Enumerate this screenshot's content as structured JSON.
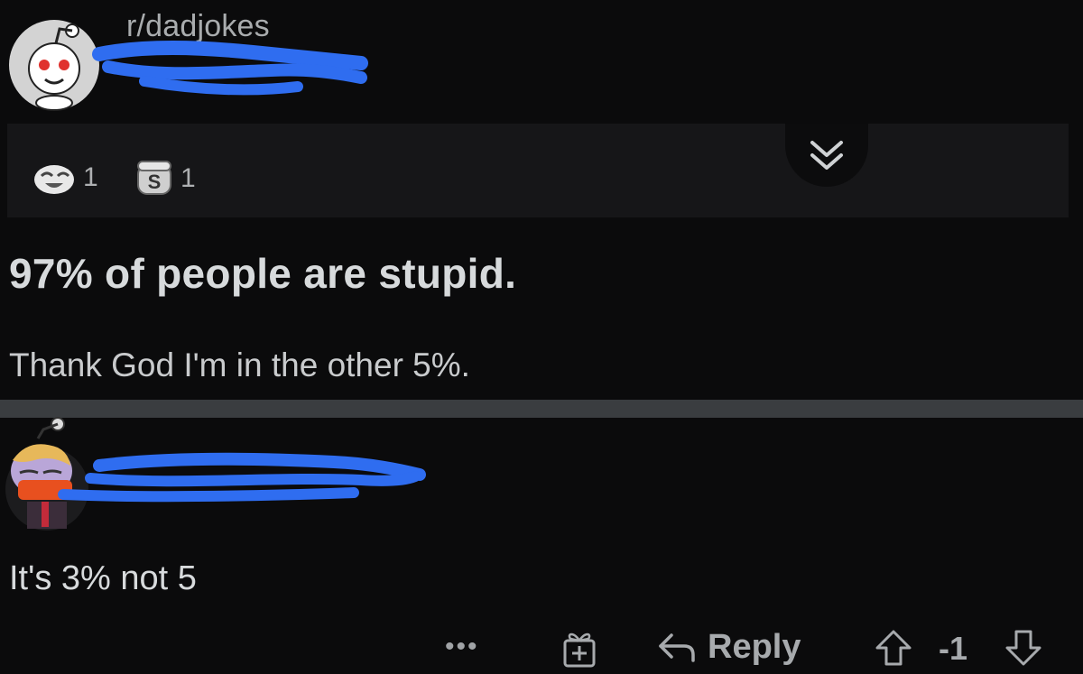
{
  "post": {
    "subreddit": "r/dadjokes",
    "awards": [
      {
        "icon": "laughing-face-award-icon",
        "count": "1"
      },
      {
        "icon": "silver-coin-award-icon",
        "count": "1"
      }
    ],
    "title": "97% of people are stupid.",
    "body": "Thank God I'm in the other 5%."
  },
  "comment": {
    "text": "It's 3% not 5",
    "actions": {
      "more": "•••",
      "reply_label": "Reply",
      "score": "-1"
    }
  },
  "colors": {
    "background": "#0b0b0c",
    "award_bar": "#161618",
    "divider": "#3a3d40",
    "redaction_scribble": "#2f6df0",
    "text_primary": "#d7dadc",
    "text_secondary": "#a9acae"
  }
}
